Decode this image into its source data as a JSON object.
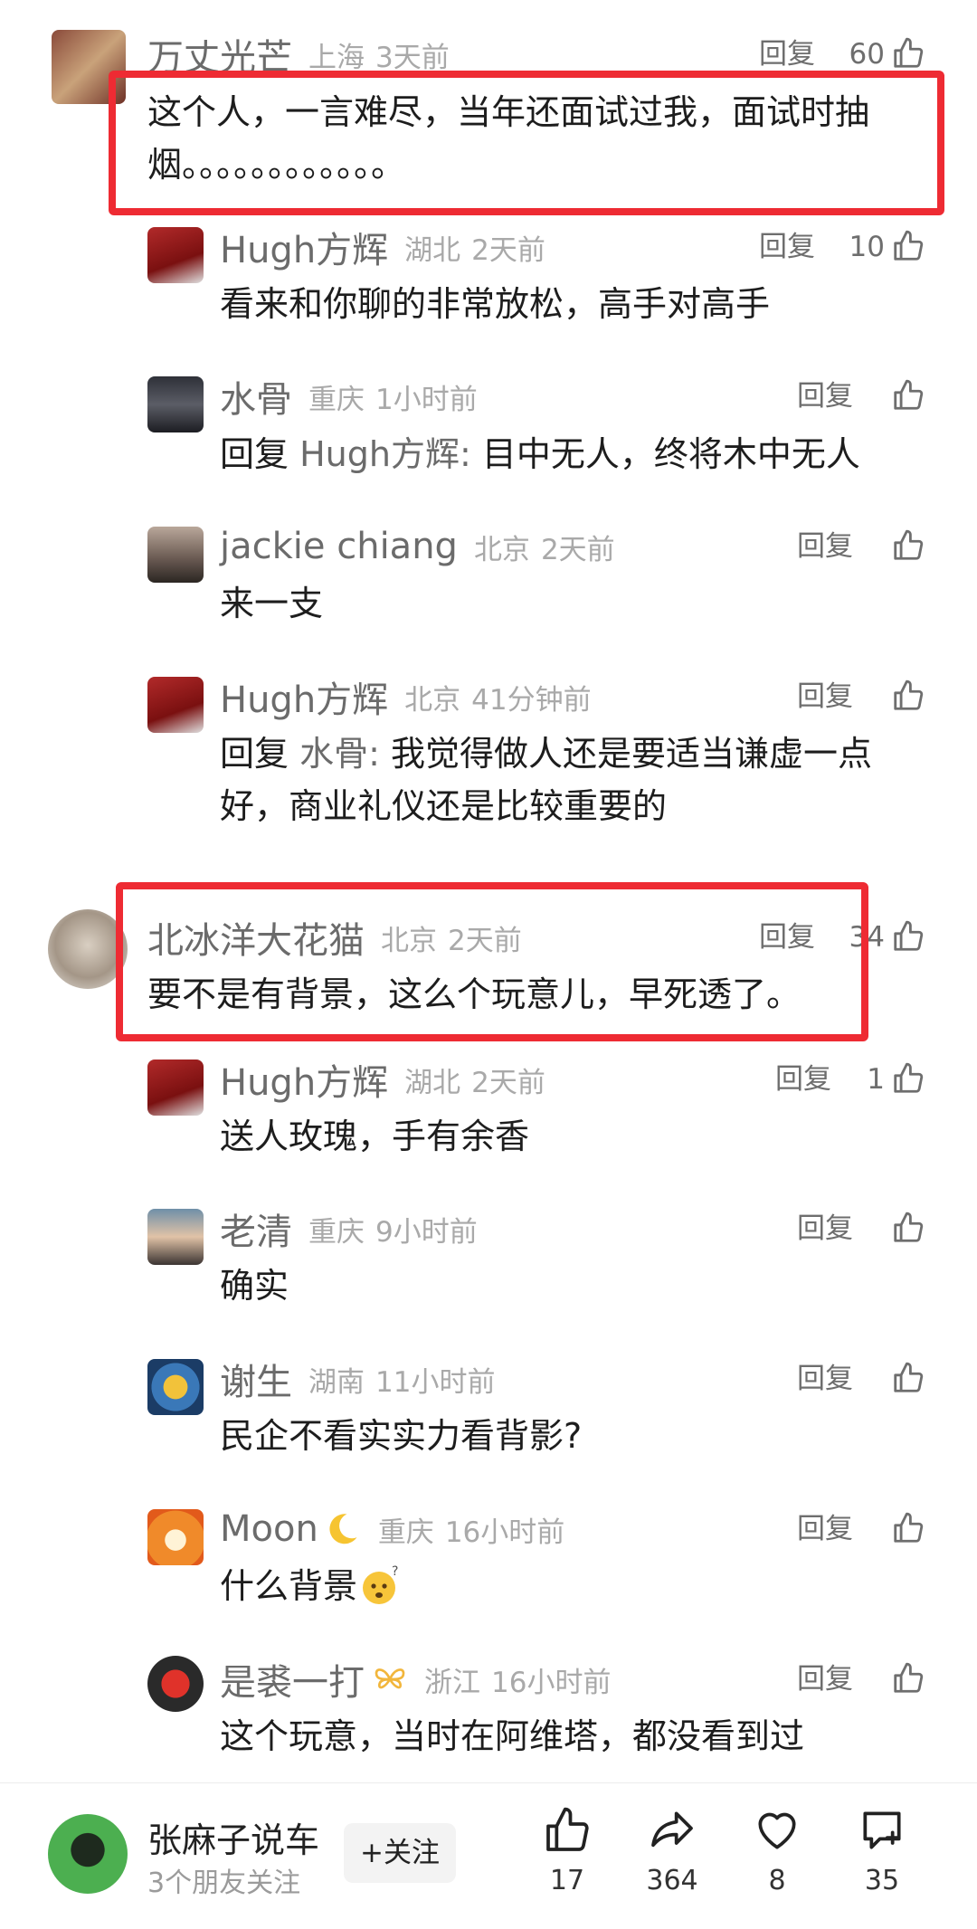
{
  "reply_label": "回复",
  "comments": [
    {
      "name": "万丈光芒",
      "location": "上海",
      "time": "3天前",
      "likes": "60",
      "text": "这个人，一言难尽，当年还面试过我，面试时抽烟。。。。。。。。。。。。"
    },
    {
      "name": "Hugh方辉",
      "location": "湖北",
      "time": "2天前",
      "likes": "10",
      "text": "看来和你聊的非常放松，高手对高手"
    },
    {
      "name": "水骨",
      "location": "重庆",
      "time": "1小时前",
      "likes": "",
      "reply_prefix": "回复 ",
      "reply_to": "Hugh方辉:",
      "text": " 目中无人，终将木中无人"
    },
    {
      "name": "jackie chiang",
      "location": "北京",
      "time": "2天前",
      "likes": "",
      "text": "来一支"
    },
    {
      "name": "Hugh方辉",
      "location": "北京",
      "time": "41分钟前",
      "likes": "",
      "reply_prefix": "回复 ",
      "reply_to": "水骨:",
      "text": " 我觉得做人还是要适当谦虚一点",
      "text2": "好，商业礼仪还是比较重要的"
    },
    {
      "name": "北冰洋大花猫",
      "location": "北京",
      "time": "2天前",
      "likes": "34",
      "text": "要不是有背景，这么个玩意儿，早死透了。"
    },
    {
      "name": "Hugh方辉",
      "location": "湖北",
      "time": "2天前",
      "likes": "1",
      "text": "送人玫瑰，手有余香"
    },
    {
      "name": "老清",
      "location": "重庆",
      "time": "9小时前",
      "likes": "",
      "text": "确实"
    },
    {
      "name": "谢生",
      "location": "湖南",
      "time": "11小时前",
      "likes": "",
      "text": "民企不看实实力看背影?"
    },
    {
      "name": "Moon",
      "location": "重庆",
      "time": "16小时前",
      "likes": "",
      "text": "什么背景"
    },
    {
      "name": "是裘一打",
      "location": "浙江",
      "time": "16小时前",
      "likes": "",
      "text": "这个玩意，当时在阿维塔，都没看到过"
    }
  ],
  "author": {
    "name": "张麻子说车",
    "subtitle": "3个朋友关注",
    "follow_label": "+关注"
  },
  "actions": {
    "like": "17",
    "share": "364",
    "favorite": "8",
    "comment": "35"
  }
}
